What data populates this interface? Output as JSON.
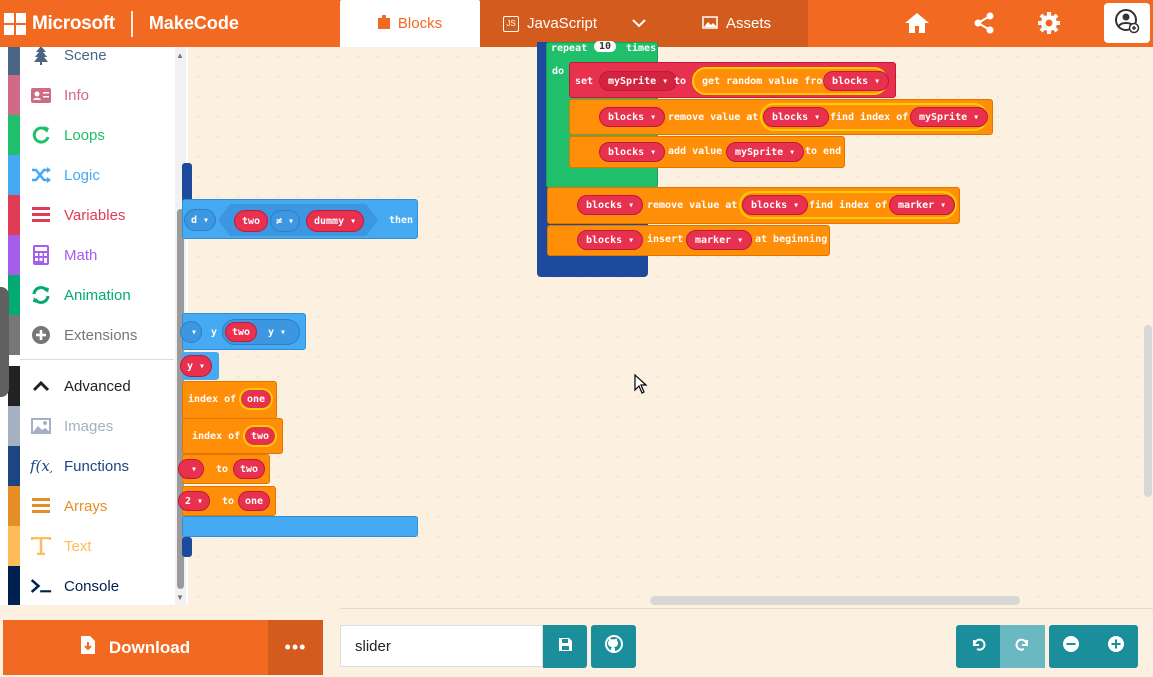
{
  "brand": {
    "ms": "Microsoft",
    "product": "MakeCode"
  },
  "tabs": {
    "blocks": "Blocks",
    "javascript": "JavaScript",
    "assets": "Assets"
  },
  "toolbox": [
    {
      "label": "Scene",
      "color": "#4b6584",
      "icon": "tree-icon"
    },
    {
      "label": "Info",
      "color": "#cf6a87",
      "icon": "id-card-icon"
    },
    {
      "label": "Loops",
      "color": "#20bf6b",
      "icon": "loop-icon"
    },
    {
      "label": "Logic",
      "color": "#45aaf2",
      "icon": "shuffle-icon"
    },
    {
      "label": "Variables",
      "color": "#e03c56",
      "icon": "list-icon"
    },
    {
      "label": "Math",
      "color": "#a55eea",
      "icon": "calculator-icon"
    },
    {
      "label": "Animation",
      "color": "#03aa74",
      "icon": "refresh-icon"
    },
    {
      "label": "Extensions",
      "color": "#777777",
      "icon": "plus-circle-icon"
    },
    {
      "label": "Advanced",
      "color": "#222222",
      "icon": "chevron-up-icon"
    },
    {
      "label": "Images",
      "color": "#a5b1c2",
      "icon": "image-icon"
    },
    {
      "label": "Functions",
      "color": "#1c4584",
      "icon": "function-icon"
    },
    {
      "label": "Arrays",
      "color": "#e58e26",
      "icon": "list-icon"
    },
    {
      "label": "Text",
      "color": "#ffbd5a",
      "icon": "text-icon"
    },
    {
      "label": "Console",
      "color": "#002050",
      "icon": "terminal-icon"
    }
  ],
  "blocks": {
    "repeat": "repeat",
    "repeat_count": "10",
    "times": "times",
    "do": "do",
    "set": "set",
    "to": "to",
    "get_random": "get random value from",
    "remove_value_at": "remove value at",
    "find_index_of": "find index of",
    "add_value": "add value",
    "to_end": "to end",
    "insert": "insert",
    "at_beginning": "at beginning",
    "var_mysprite": "mySprite",
    "var_blocks": "blocks",
    "var_marker": "marker",
    "var_two": "two",
    "var_dummy": "dummy",
    "var_one": "one",
    "op_ne": "≠",
    "then": "then",
    "frag_d": "d",
    "frag_y": "y",
    "frag_index_of": "index of",
    "frag_to": "to",
    "frag_two": "two",
    "frag_one": "one",
    "frag_s2": "2"
  },
  "project_name": "slider",
  "download_label": "Download",
  "more_label": "•••"
}
